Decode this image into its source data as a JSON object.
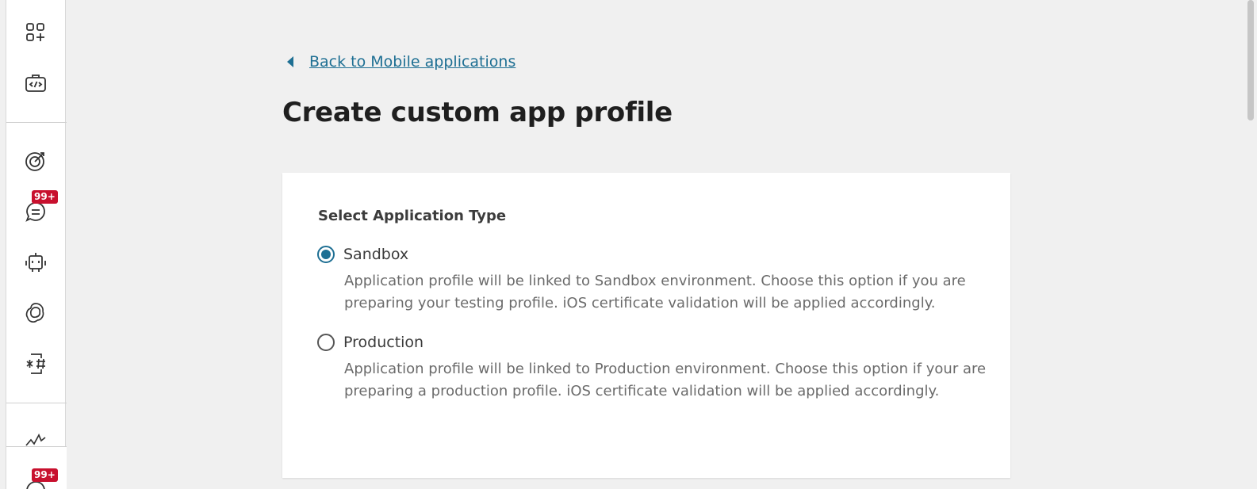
{
  "sidebar": {
    "icons": [
      {
        "name": "add-apps-icon"
      },
      {
        "name": "code-briefcase-icon"
      },
      {
        "name": "target-icon"
      },
      {
        "name": "chat-icon",
        "badge": "99+"
      },
      {
        "name": "bot-icon"
      },
      {
        "name": "ai-swirl-icon"
      },
      {
        "name": "mobile-hash-icon"
      },
      {
        "name": "activity-icon"
      },
      {
        "name": "conversations-icon",
        "badge": "99+"
      }
    ]
  },
  "back_link": {
    "label": "Back to Mobile applications"
  },
  "page_title": "Create custom app profile",
  "form": {
    "section_label": "Select Application Type",
    "options": [
      {
        "label": "Sandbox",
        "selected": true,
        "description": "Application profile will be linked to Sandbox environment. Choose this option if you are preparing your testing profile. iOS certificate validation will be applied accordingly."
      },
      {
        "label": "Production",
        "selected": false,
        "description": "Application profile will be linked to Production environment. Choose this option if your are preparing a production profile. iOS certificate validation will be applied accordingly."
      }
    ]
  },
  "colors": {
    "accent": "#1e6f93",
    "badge": "#c8102e",
    "background": "#f0f0f0"
  }
}
